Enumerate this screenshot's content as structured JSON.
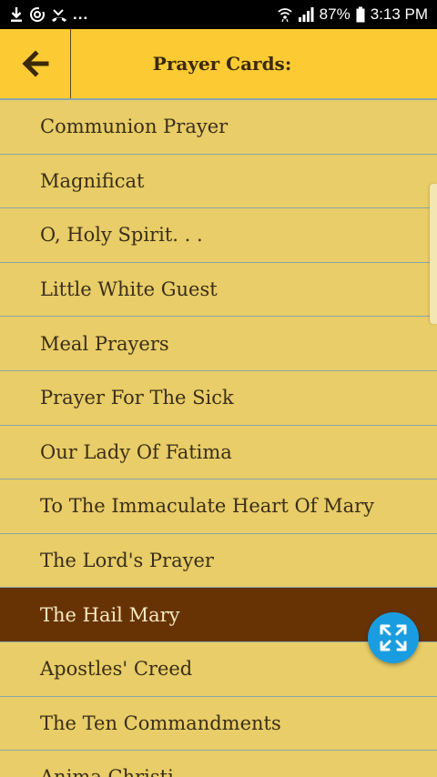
{
  "status_bar": {
    "battery": "87%",
    "time": "3:13 PM",
    "icons": [
      "download-icon",
      "sync-icon",
      "missed-call-icon",
      "more-notifications-icon",
      "wifi-icon",
      "signal-icon",
      "battery-icon"
    ],
    "more": "..."
  },
  "app_bar": {
    "title": "Prayer Cards:",
    "back_icon": "back-arrow-icon"
  },
  "prayers": [
    {
      "label": "Communion Prayer",
      "selected": false
    },
    {
      "label": "Magnificat",
      "selected": false
    },
    {
      "label": "O, Holy Spirit. . .",
      "selected": false
    },
    {
      "label": "Little White Guest",
      "selected": false
    },
    {
      "label": "Meal Prayers",
      "selected": false
    },
    {
      "label": "Prayer For The Sick",
      "selected": false
    },
    {
      "label": "Our Lady Of Fatima",
      "selected": false
    },
    {
      "label": "To The Immaculate Heart Of Mary",
      "selected": false
    },
    {
      "label": "The Lord's Prayer",
      "selected": false
    },
    {
      "label": "The Hail Mary",
      "selected": true
    },
    {
      "label": "Apostles' Creed",
      "selected": false
    },
    {
      "label": "The Ten Commandments",
      "selected": false
    },
    {
      "label": "Anima Christi",
      "selected": false
    }
  ],
  "fab": {
    "icon": "expand-icon"
  },
  "colors": {
    "background": "#e8cd68",
    "app_bar": "#fcca33",
    "selected_row": "#673305",
    "divider": "#89a6a8",
    "fab": "#1a9de0"
  }
}
